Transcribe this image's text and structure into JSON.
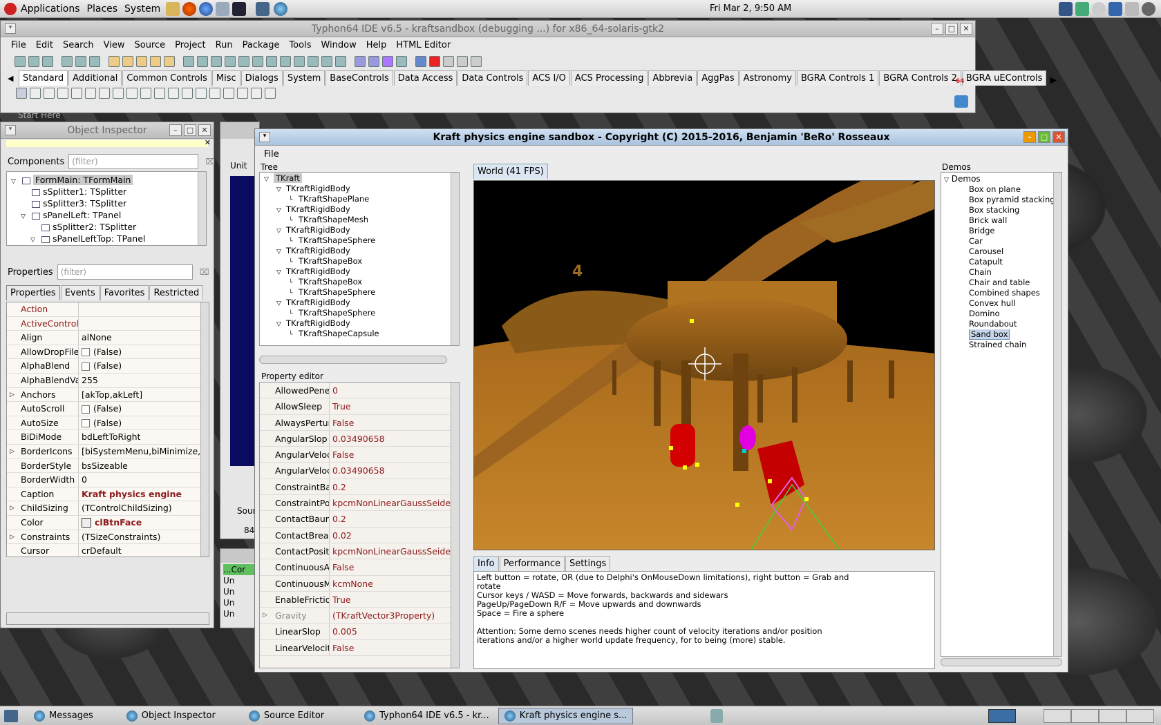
{
  "top_panel": {
    "menus": [
      "Applications",
      "Places",
      "System"
    ],
    "clock": "Fri Mar  2,  9:50 AM"
  },
  "ide": {
    "title": "Typhon64 IDE v6.5 - kraftsandbox (debugging ...) for x86_64-solaris-gtk2",
    "menu": [
      "File",
      "Edit",
      "Search",
      "View",
      "Source",
      "Project",
      "Run",
      "Package",
      "Tools",
      "Window",
      "Help",
      "HTML Editor"
    ],
    "palette_tabs": [
      "Standard",
      "Additional",
      "Common Controls",
      "Misc",
      "Dialogs",
      "System",
      "BaseControls",
      "Data Access",
      "Data Controls",
      "ACS I/O",
      "ACS Processing",
      "Abbrevia",
      "AggPas",
      "Astronomy",
      "BGRA Controls 1",
      "BGRA Controls 2",
      "BGRA uEControls"
    ],
    "badge": "64"
  },
  "object_inspector": {
    "title": "Object Inspector",
    "components_label": "Components",
    "filter_placeholder": "(filter)",
    "tree": [
      {
        "label": "FormMain: TFormMain",
        "indent": 0,
        "sel": true
      },
      {
        "label": "sSplitter1: TSplitter",
        "indent": 1
      },
      {
        "label": "sSplitter3: TSplitter",
        "indent": 1
      },
      {
        "label": "sPanelLeft: TPanel",
        "indent": 1
      },
      {
        "label": "sSplitter2: TSplitter",
        "indent": 2
      },
      {
        "label": "sPanelLeftTop: TPanel",
        "indent": 2
      }
    ],
    "properties_label": "Properties",
    "tabs": [
      "Properties",
      "Events",
      "Favorites",
      "Restricted"
    ],
    "rows": [
      {
        "k": "Action",
        "v": "",
        "red": true
      },
      {
        "k": "ActiveControl",
        "v": "",
        "red": true
      },
      {
        "k": "Align",
        "v": "alNone"
      },
      {
        "k": "AllowDropFiles",
        "v": "(False)",
        "check": true
      },
      {
        "k": "AlphaBlend",
        "v": "(False)",
        "check": true
      },
      {
        "k": "AlphaBlendValu",
        "v": "255"
      },
      {
        "k": "Anchors",
        "v": "[akTop,akLeft]",
        "exp": true
      },
      {
        "k": "AutoScroll",
        "v": "(False)",
        "check": true
      },
      {
        "k": "AutoSize",
        "v": "(False)",
        "check": true
      },
      {
        "k": "BiDiMode",
        "v": "bdLeftToRight"
      },
      {
        "k": "BorderIcons",
        "v": "[biSystemMenu,biMinimize,",
        "exp": true
      },
      {
        "k": "BorderStyle",
        "v": "bsSizeable"
      },
      {
        "k": "BorderWidth",
        "v": "0"
      },
      {
        "k": "Caption",
        "v": "Kraft physics engine",
        "bold": true
      },
      {
        "k": "ChildSizing",
        "v": "(TControlChildSizing)",
        "exp": true
      },
      {
        "k": "Color",
        "v": "clBtnFace",
        "bold": true,
        "swatch": true
      },
      {
        "k": "Constraints",
        "v": "(TSizeConstraints)",
        "exp": true
      },
      {
        "k": "Cursor",
        "v": "crDefault"
      }
    ]
  },
  "kraft": {
    "title": "Kraft physics engine sandbox - Copyright (C) 2015-2016, Benjamin 'BeRo' Rosseaux",
    "menu": [
      "File"
    ],
    "tree_label": "Tree",
    "tree": [
      {
        "label": "TKraft",
        "indent": 0,
        "sel": true
      },
      {
        "label": "TKraftRigidBody",
        "indent": 1
      },
      {
        "label": "TKraftShapePlane",
        "indent": 2
      },
      {
        "label": "TKraftRigidBody",
        "indent": 1
      },
      {
        "label": "TKraftShapeMesh",
        "indent": 2
      },
      {
        "label": "TKraftRigidBody",
        "indent": 1
      },
      {
        "label": "TKraftShapeSphere",
        "indent": 2
      },
      {
        "label": "TKraftRigidBody",
        "indent": 1
      },
      {
        "label": "TKraftShapeBox",
        "indent": 2
      },
      {
        "label": "TKraftRigidBody",
        "indent": 1
      },
      {
        "label": "TKraftShapeBox",
        "indent": 2
      },
      {
        "label": "TKraftShapeSphere",
        "indent": 2
      },
      {
        "label": "TKraftRigidBody",
        "indent": 1
      },
      {
        "label": "TKraftShapeSphere",
        "indent": 2
      },
      {
        "label": "TKraftRigidBody",
        "indent": 1
      },
      {
        "label": "TKraftShapeCapsule",
        "indent": 2
      }
    ],
    "property_editor_label": "Property editor",
    "props": [
      {
        "k": "AllowedPenet",
        "v": "0"
      },
      {
        "k": "AllowSleep",
        "v": "True"
      },
      {
        "k": "AlwaysPertur",
        "v": "False"
      },
      {
        "k": "AngularSlop",
        "v": "0.03490658"
      },
      {
        "k": "AngularVeloci",
        "v": "False"
      },
      {
        "k": "AngularVeloci",
        "v": "0.03490658"
      },
      {
        "k": "ConstraintBau",
        "v": "0.2"
      },
      {
        "k": "ConstraintPos",
        "v": "kpcmNonLinearGaussSeidel"
      },
      {
        "k": "ContactBaum",
        "v": "0.2"
      },
      {
        "k": "ContactBreak",
        "v": "0.02"
      },
      {
        "k": "ContactPositi",
        "v": "kpcmNonLinearGaussSeidel"
      },
      {
        "k": "ContinuousAg",
        "v": "False"
      },
      {
        "k": "ContinuousMc",
        "v": "kcmNone"
      },
      {
        "k": "EnableFriction",
        "v": "True"
      },
      {
        "k": "Gravity",
        "v": "(TKraftVector3Property)",
        "exp": true,
        "gray": true
      },
      {
        "k": "LinearSlop",
        "v": "0.005"
      },
      {
        "k": "LinearVelocity",
        "v": "False"
      }
    ],
    "world_tab": "World (41 FPS)",
    "scene_label": "4",
    "info_tabs": [
      "Info",
      "Performance",
      "Settings"
    ],
    "info_text": "Left button = rotate, OR (due to Delphi's OnMouseDown limitations), right button = Grab and\nrotate\nCursor keys / WASD = Move forwards, backwards and sidewars\nPageUp/PageDown R/F = Move upwards and downwards\nSpace = Fire a sphere\n\nAttention: Some demo scenes needs higher count of velocity iterations and/or position\niterations and/or a higher world update frequency, for to being (more) stable.",
    "demos_label": "Demos",
    "demos_root": "Demos",
    "demos": [
      "Box on plane",
      "Box pyramid stacking",
      "Box stacking",
      "Brick wall",
      "Bridge",
      "Car",
      "Carousel",
      "Catapult",
      "Chain",
      "Chair and table",
      "Combined shapes",
      "Convex hull",
      "Domino",
      "Roundabout",
      "Sand box",
      "Strained chain"
    ],
    "selected_demo": "Sand box"
  },
  "background_windows": {
    "start_here": "Start Here",
    "unit_tab": "Unit",
    "source_tab": "Sour",
    "line_no": "84",
    "messages": [
      "...Cor",
      "Un",
      "Un",
      "Un",
      "Un"
    ]
  },
  "taskbar": [
    "Messages",
    "Object Inspector",
    "Source Editor",
    "Typhon64 IDE v6.5 - kr...",
    "Kraft physics engine s..."
  ]
}
